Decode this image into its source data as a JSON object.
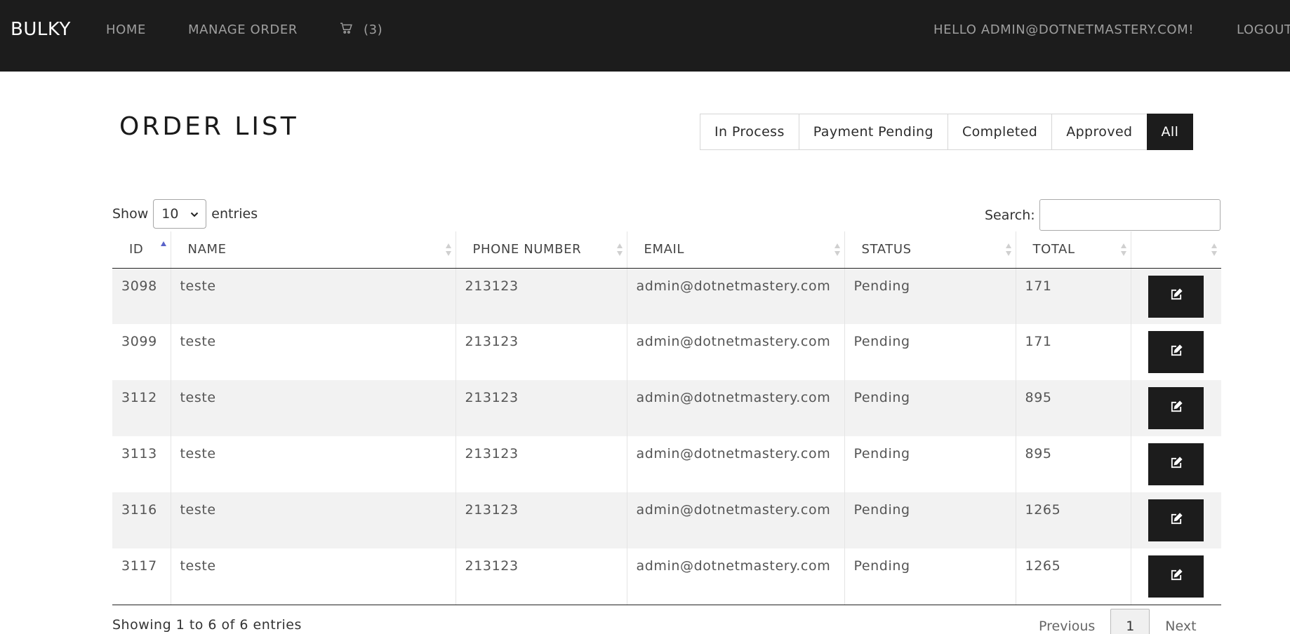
{
  "navbar": {
    "brand": "BULKY",
    "home": "HOME",
    "manage_order": "MANAGE ORDER",
    "cart_count": "(3)",
    "greeting": "HELLO ADMIN@DOTNETMASTERY.COM!",
    "logout": "LOGOUT",
    "icons": {
      "cart": "cart-icon"
    }
  },
  "page": {
    "title": "ORDER LIST",
    "filters": [
      {
        "label": "In Process",
        "active": false
      },
      {
        "label": "Payment Pending",
        "active": false
      },
      {
        "label": "Completed",
        "active": false
      },
      {
        "label": "Approved",
        "active": false
      },
      {
        "label": "All",
        "active": true
      }
    ]
  },
  "datatable": {
    "show_label": "Show",
    "entries_label": "entries",
    "page_length": "10",
    "search_label": "Search:",
    "search_value": "",
    "columns": [
      "ID",
      "NAME",
      "PHONE NUMBER",
      "EMAIL",
      "STATUS",
      "TOTAL",
      ""
    ],
    "sorted_column": "ID",
    "sort_direction": "ascending",
    "rows": [
      {
        "id": "3098",
        "name": "teste",
        "phone": "213123",
        "email": "admin@dotnetmastery.com",
        "status": "Pending",
        "total": "171"
      },
      {
        "id": "3099",
        "name": "teste",
        "phone": "213123",
        "email": "admin@dotnetmastery.com",
        "status": "Pending",
        "total": "171"
      },
      {
        "id": "3112",
        "name": "teste",
        "phone": "213123",
        "email": "admin@dotnetmastery.com",
        "status": "Pending",
        "total": "895"
      },
      {
        "id": "3113",
        "name": "teste",
        "phone": "213123",
        "email": "admin@dotnetmastery.com",
        "status": "Pending",
        "total": "895"
      },
      {
        "id": "3116",
        "name": "teste",
        "phone": "213123",
        "email": "admin@dotnetmastery.com",
        "status": "Pending",
        "total": "1265"
      },
      {
        "id": "3117",
        "name": "teste",
        "phone": "213123",
        "email": "admin@dotnetmastery.com",
        "status": "Pending",
        "total": "1265"
      }
    ],
    "row_action_icon": "edit-icon",
    "info": "Showing 1 to 6 of 6 entries",
    "pagination": {
      "previous": "Previous",
      "current": "1",
      "next": "Next"
    }
  },
  "colors": {
    "navbar_bg": "#1c1c1c",
    "active_filter_bg": "#1c1c1c",
    "stripe_bg": "#f2f2f2",
    "sort_active": "#5a63c9"
  }
}
